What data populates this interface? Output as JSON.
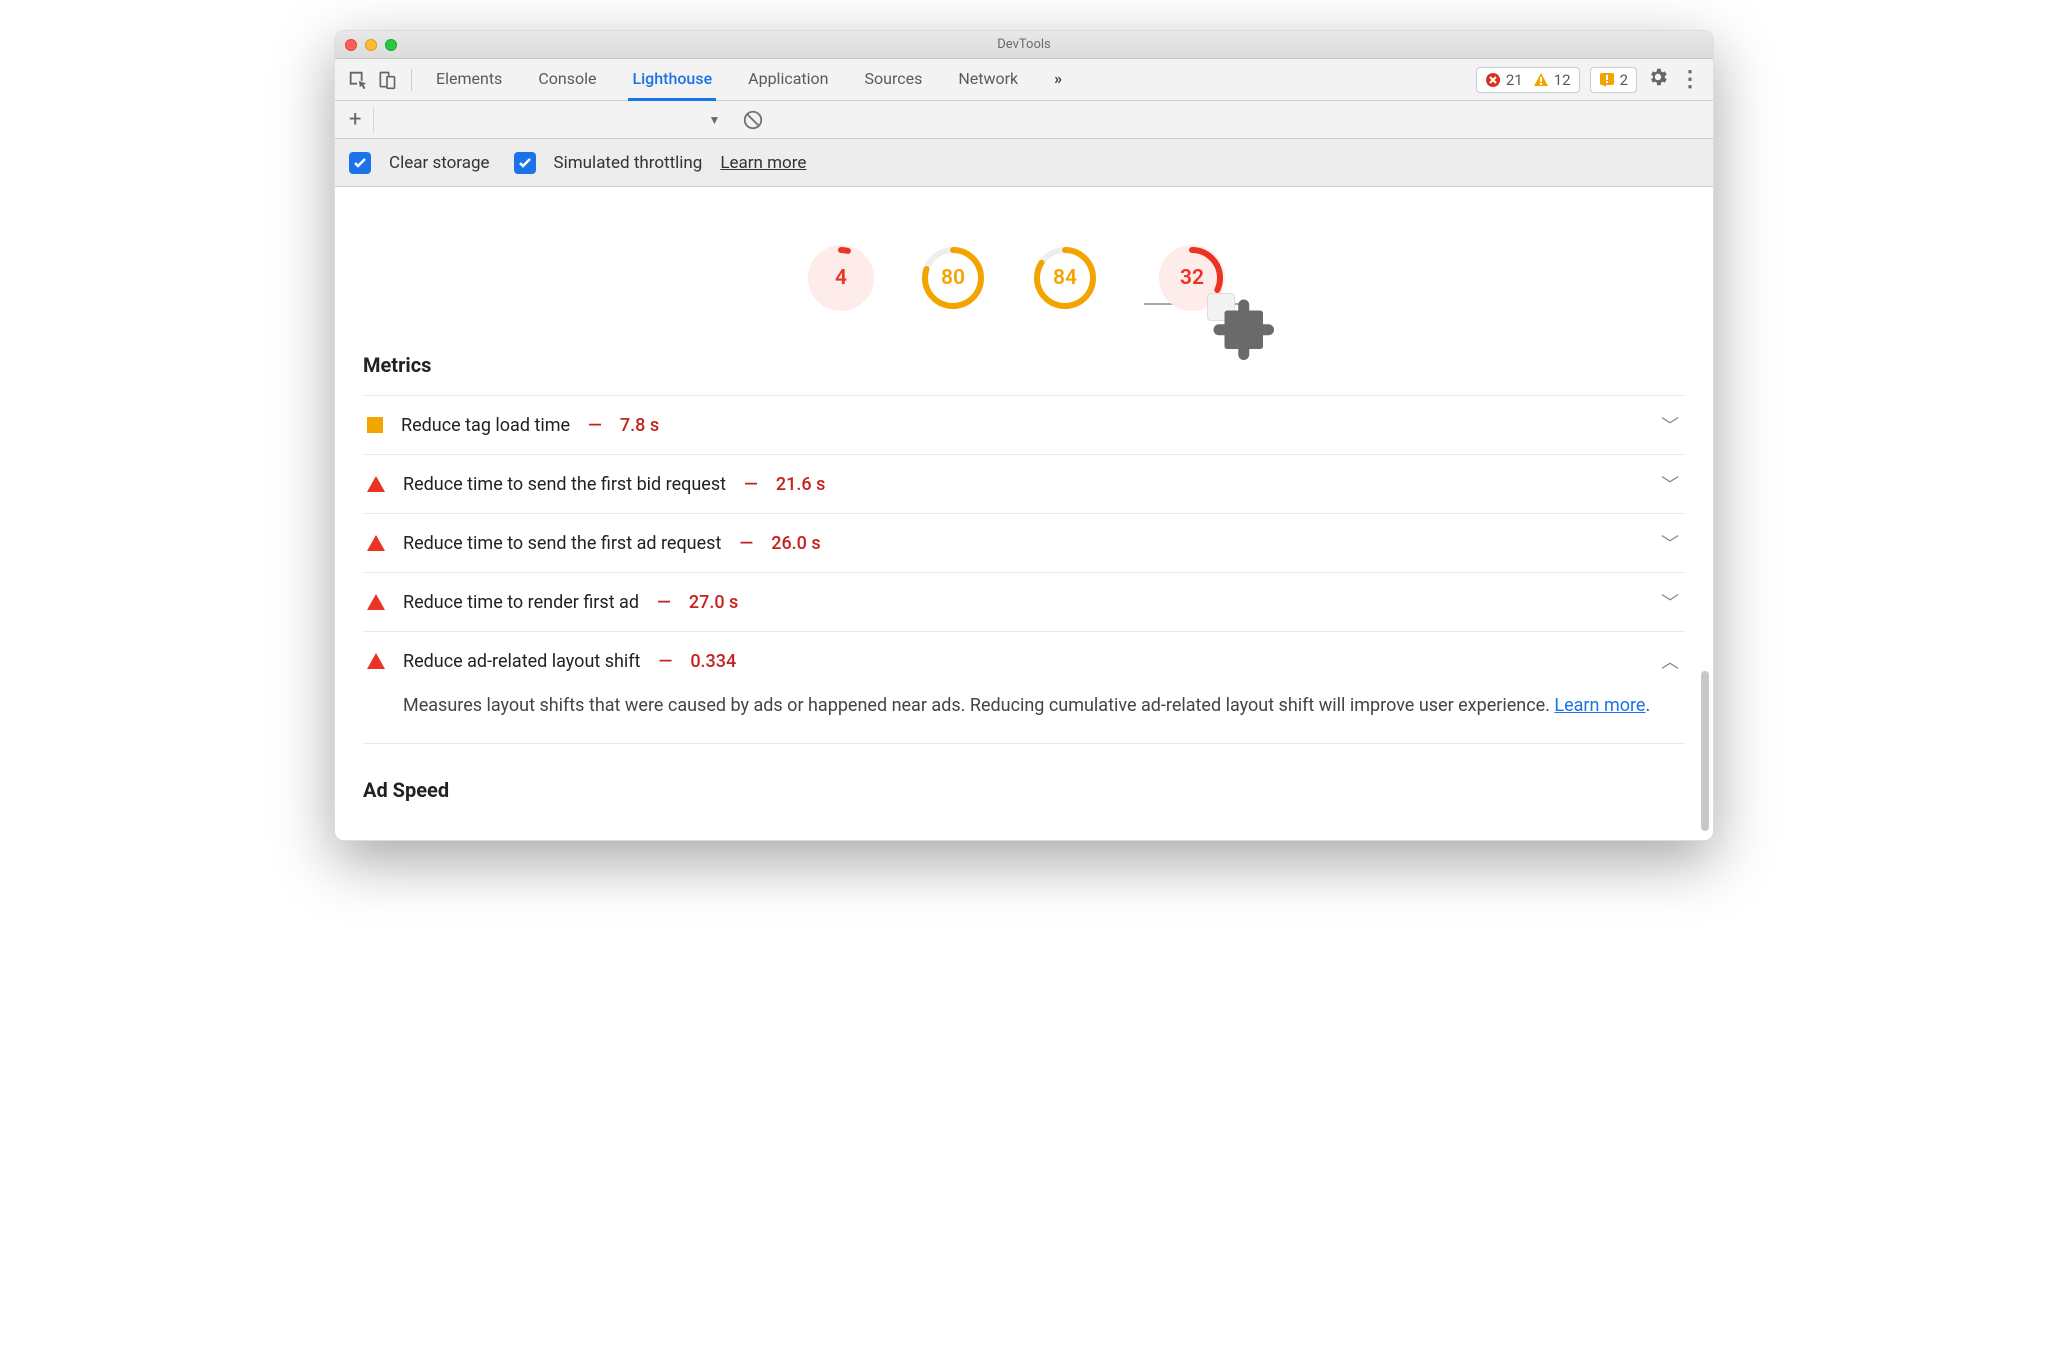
{
  "window": {
    "title": "DevTools"
  },
  "tabs": [
    "Elements",
    "Console",
    "Lighthouse",
    "Application",
    "Sources",
    "Network"
  ],
  "active_tab_index": 2,
  "toolbar": {
    "errors": 21,
    "warnings": 12,
    "issues": 2
  },
  "options": {
    "clear_storage": {
      "checked": true,
      "label": "Clear storage"
    },
    "simulated_throttling": {
      "checked": true,
      "label": "Simulated throttling"
    },
    "learn_more": "Learn more"
  },
  "gauges": [
    {
      "score": 4,
      "color": "#eb3323",
      "fill": 0.04,
      "bg": "#fdecea"
    },
    {
      "score": 80,
      "color": "#f4a400",
      "fill": 0.8,
      "bg": "transparent"
    },
    {
      "score": 84,
      "color": "#f4a400",
      "fill": 0.84,
      "bg": "transparent"
    },
    {
      "score": 32,
      "color": "#eb3323",
      "fill": 0.32,
      "bg": "#fdecea",
      "plugin": true
    }
  ],
  "metrics_heading": "Metrics",
  "audits": [
    {
      "icon": "square",
      "title": "Reduce tag load time",
      "value": "7.8 s",
      "expanded": false
    },
    {
      "icon": "triangle",
      "title": "Reduce time to send the first bid request",
      "value": "21.6 s",
      "expanded": false
    },
    {
      "icon": "triangle",
      "title": "Reduce time to send the first ad request",
      "value": "26.0 s",
      "expanded": false
    },
    {
      "icon": "triangle",
      "title": "Reduce time to render first ad",
      "value": "27.0 s",
      "expanded": false
    },
    {
      "icon": "triangle",
      "title": "Reduce ad-related layout shift",
      "value": "0.334",
      "expanded": true,
      "description": "Measures layout shifts that were caused by ads or happened near ads. Reducing cumulative ad-related layout shift will improve user experience. ",
      "link_text": "Learn more"
    }
  ],
  "ad_speed_heading": "Ad Speed"
}
